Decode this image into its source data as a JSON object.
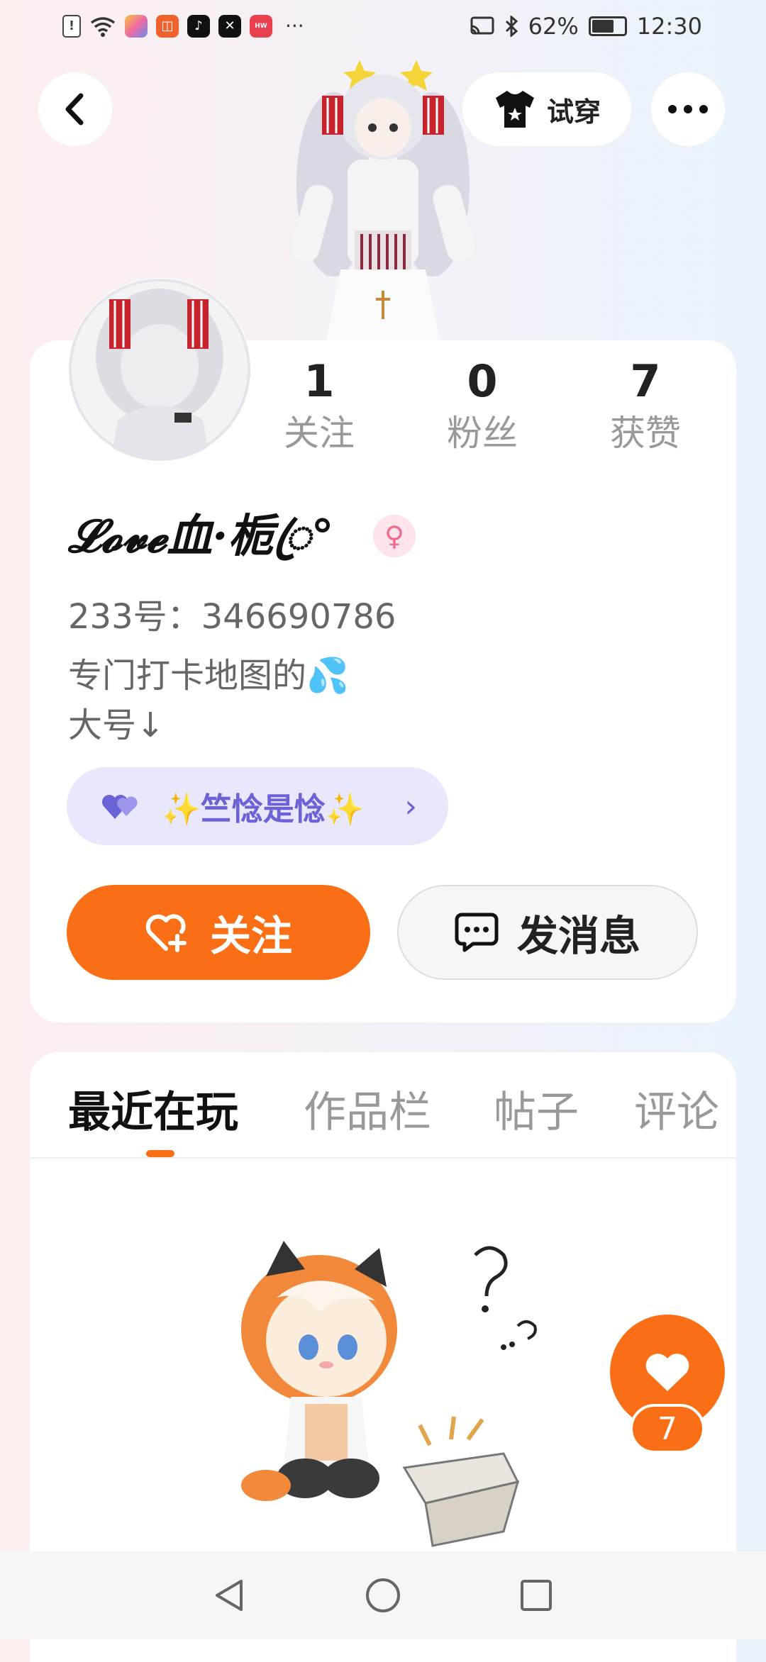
{
  "status_bar": {
    "battery": "62%",
    "time": "12:30",
    "overflow": "···",
    "app_icons": [
      "alert-icon",
      "wifi-icon",
      "app-icon-1",
      "app-icon-2",
      "tiktok-icon",
      "capcut-icon",
      "huawei-icon"
    ],
    "right_icons": [
      "cast-icon",
      "bluetooth-icon"
    ]
  },
  "header": {
    "tryon_label": "试穿"
  },
  "stats": [
    {
      "value": "1",
      "label": "关注"
    },
    {
      "value": "0",
      "label": "粉丝"
    },
    {
      "value": "7",
      "label": "获赞"
    }
  ],
  "profile": {
    "nickname": "𝓛𝓸𝓿𝓮血·栀ꦿ°",
    "gender_symbol": "♀",
    "id_line": "233号：346690786",
    "bio": "专门打卡地图的💦\n大号↓",
    "tag_text": "✨竺惗是惗✨",
    "tag_chevron": "›"
  },
  "actions": {
    "follow_label": "关注",
    "message_label": "发消息"
  },
  "tabs": [
    {
      "label": "最近在玩",
      "active": true
    },
    {
      "label": "作品栏",
      "active": false
    },
    {
      "label": "帖子",
      "active": false
    },
    {
      "label": "评论",
      "active": false
    }
  ],
  "likes_badge": "7",
  "colors": {
    "accent": "#fa6f16",
    "tag_bg": "#e8e7fb",
    "tag_text": "#6b62d6",
    "gender_bg": "#fde3ea"
  }
}
